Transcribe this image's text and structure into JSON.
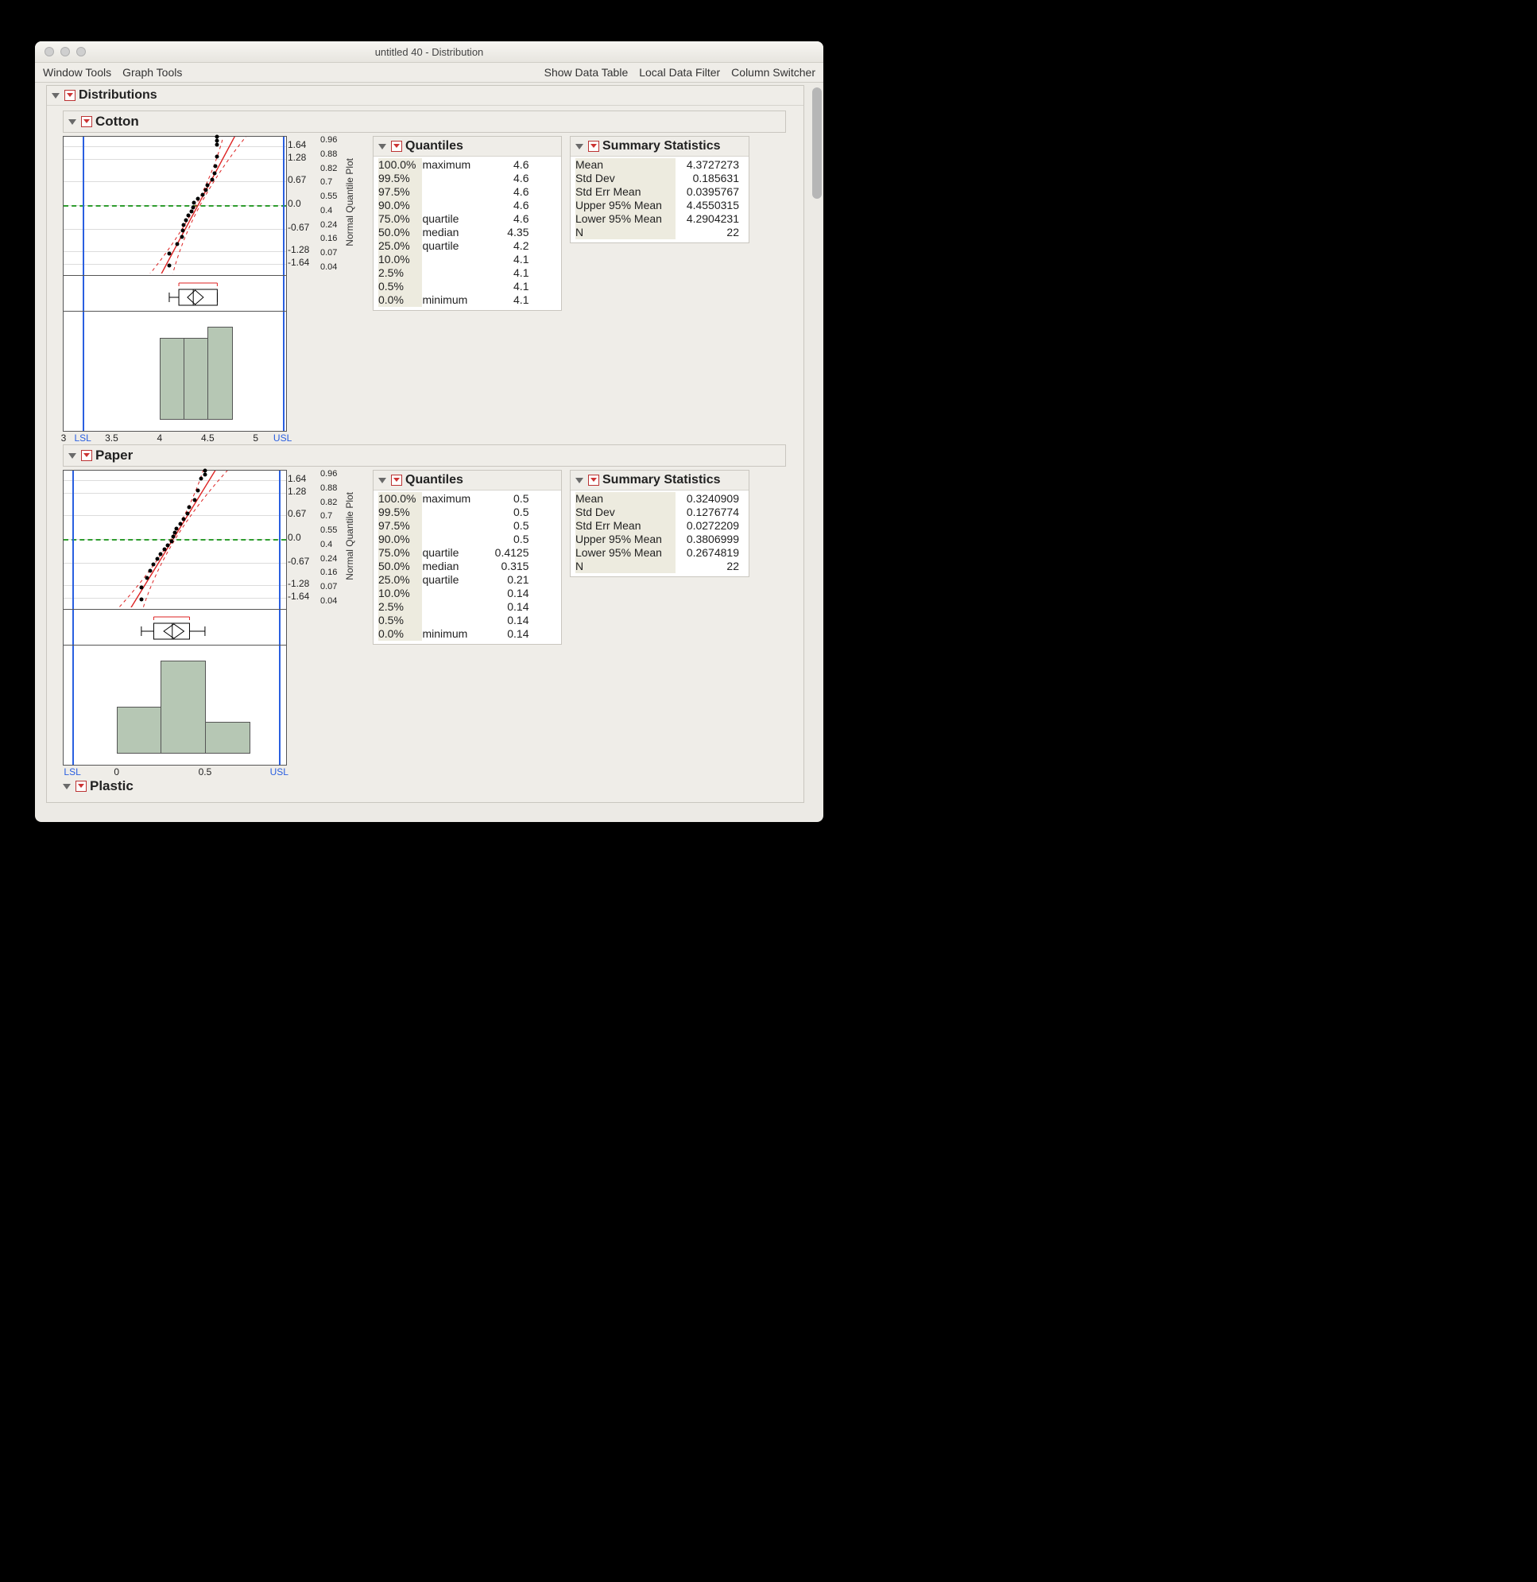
{
  "window": {
    "title": "untitled 40 - Distribution"
  },
  "menu": {
    "left": [
      "Window Tools",
      "Graph Tools"
    ],
    "right": [
      "Show Data Table",
      "Local Data Filter",
      "Column Switcher"
    ]
  },
  "root": {
    "title": "Distributions"
  },
  "sections": [
    {
      "name": "Cotton",
      "qplot": {
        "leftLabels": [
          "1.64",
          "1.28",
          "0.67",
          "0.0",
          "-0.67",
          "-1.28",
          "-1.64"
        ],
        "rightLabels": [
          "0.96",
          "0.88",
          "0.82",
          "0.7",
          "0.55",
          "0.4",
          "0.24",
          "0.16",
          "0.07",
          "0.04"
        ],
        "vtitle": "Normal Quantile Plot",
        "lsl": "LSL",
        "usl": "USL"
      },
      "histAxis": [
        "3",
        "3.5",
        "4",
        "4.5",
        "5"
      ],
      "quantiles": {
        "title": "Quantiles",
        "rows": [
          {
            "p": "100.0%",
            "t": "maximum",
            "v": "4.6"
          },
          {
            "p": "99.5%",
            "t": "",
            "v": "4.6"
          },
          {
            "p": "97.5%",
            "t": "",
            "v": "4.6"
          },
          {
            "p": "90.0%",
            "t": "",
            "v": "4.6"
          },
          {
            "p": "75.0%",
            "t": "quartile",
            "v": "4.6"
          },
          {
            "p": "50.0%",
            "t": "median",
            "v": "4.35"
          },
          {
            "p": "25.0%",
            "t": "quartile",
            "v": "4.2"
          },
          {
            "p": "10.0%",
            "t": "",
            "v": "4.1"
          },
          {
            "p": "2.5%",
            "t": "",
            "v": "4.1"
          },
          {
            "p": "0.5%",
            "t": "",
            "v": "4.1"
          },
          {
            "p": "0.0%",
            "t": "minimum",
            "v": "4.1"
          }
        ]
      },
      "summary": {
        "title": "Summary Statistics",
        "rows": [
          {
            "l": "Mean",
            "v": "4.3727273"
          },
          {
            "l": "Std Dev",
            "v": "0.185631"
          },
          {
            "l": "Std Err Mean",
            "v": "0.0395767"
          },
          {
            "l": "Upper 95% Mean",
            "v": "4.4550315"
          },
          {
            "l": "Lower 95% Mean",
            "v": "4.2904231"
          },
          {
            "l": "N",
            "v": "22"
          }
        ]
      }
    },
    {
      "name": "Paper",
      "qplot": {
        "leftLabels": [
          "1.64",
          "1.28",
          "0.67",
          "0.0",
          "-0.67",
          "-1.28",
          "-1.64"
        ],
        "rightLabels": [
          "0.96",
          "0.88",
          "0.82",
          "0.7",
          "0.55",
          "0.4",
          "0.24",
          "0.16",
          "0.07",
          "0.04"
        ],
        "vtitle": "Normal Quantile Plot",
        "lsl": "LSL",
        "usl": "USL"
      },
      "histAxis": [
        "0",
        "0.5"
      ],
      "quantiles": {
        "title": "Quantiles",
        "rows": [
          {
            "p": "100.0%",
            "t": "maximum",
            "v": "0.5"
          },
          {
            "p": "99.5%",
            "t": "",
            "v": "0.5"
          },
          {
            "p": "97.5%",
            "t": "",
            "v": "0.5"
          },
          {
            "p": "90.0%",
            "t": "",
            "v": "0.5"
          },
          {
            "p": "75.0%",
            "t": "quartile",
            "v": "0.4125"
          },
          {
            "p": "50.0%",
            "t": "median",
            "v": "0.315"
          },
          {
            "p": "25.0%",
            "t": "quartile",
            "v": "0.21"
          },
          {
            "p": "10.0%",
            "t": "",
            "v": "0.14"
          },
          {
            "p": "2.5%",
            "t": "",
            "v": "0.14"
          },
          {
            "p": "0.5%",
            "t": "",
            "v": "0.14"
          },
          {
            "p": "0.0%",
            "t": "minimum",
            "v": "0.14"
          }
        ]
      },
      "summary": {
        "title": "Summary Statistics",
        "rows": [
          {
            "l": "Mean",
            "v": "0.3240909"
          },
          {
            "l": "Std Dev",
            "v": "0.1276774"
          },
          {
            "l": "Std Err Mean",
            "v": "0.0272209"
          },
          {
            "l": "Upper 95% Mean",
            "v": "0.3806999"
          },
          {
            "l": "Lower 95% Mean",
            "v": "0.2674819"
          },
          {
            "l": "N",
            "v": "22"
          }
        ]
      }
    }
  ],
  "cutoff": {
    "name": "Plastic"
  },
  "chart_data": [
    {
      "variable": "Cotton",
      "normal_quantile_plot": {
        "type": "scatter",
        "title": "Normal Quantile Plot",
        "ylim": [
          -1.9,
          1.9
        ],
        "xlim": [
          3.0,
          5.3
        ],
        "x": [
          4.1,
          4.1,
          4.18,
          4.23,
          4.24,
          4.25,
          4.27,
          4.3,
          4.33,
          4.35,
          4.36,
          4.4,
          4.45,
          4.48,
          4.5,
          4.55,
          4.57,
          4.58,
          4.6,
          4.6,
          4.6,
          4.6
        ],
        "normal_quantile": [
          -1.69,
          -1.34,
          -1.08,
          -0.88,
          -0.71,
          -0.56,
          -0.42,
          -0.29,
          -0.17,
          -0.06,
          0.06,
          0.17,
          0.29,
          0.42,
          0.56,
          0.71,
          0.88,
          1.08,
          1.34,
          1.69,
          1.8,
          1.9
        ],
        "fit_line": {
          "xrange": [
            3.9,
            4.9
          ],
          "yrange": [
            -2.5,
            2.5
          ]
        },
        "spec_limits": {
          "LSL": 3.2,
          "USL": 5.28
        }
      },
      "box_plot": {
        "type": "boxplot",
        "min": 4.1,
        "q1": 4.2,
        "median": 4.35,
        "q3": 4.6,
        "max": 4.6,
        "mean": 4.37,
        "ci": [
          4.29,
          4.455
        ]
      },
      "histogram": {
        "type": "bar",
        "bin_edges": [
          4.0,
          4.25,
          4.5,
          4.75
        ],
        "counts": [
          7,
          7,
          8
        ],
        "xlim": [
          3.0,
          5.3
        ]
      }
    },
    {
      "variable": "Paper",
      "normal_quantile_plot": {
        "type": "scatter",
        "title": "Normal Quantile Plot",
        "ylim": [
          -1.9,
          1.9
        ],
        "xlim": [
          -0.3,
          0.95
        ],
        "x": [
          0.14,
          0.14,
          0.17,
          0.19,
          0.21,
          0.23,
          0.25,
          0.27,
          0.29,
          0.31,
          0.32,
          0.33,
          0.34,
          0.36,
          0.38,
          0.4,
          0.41,
          0.44,
          0.46,
          0.48,
          0.5,
          0.5
        ],
        "normal_quantile": [
          -1.69,
          -1.34,
          -1.08,
          -0.88,
          -0.71,
          -0.56,
          -0.42,
          -0.29,
          -0.17,
          -0.06,
          0.06,
          0.17,
          0.29,
          0.42,
          0.56,
          0.71,
          0.88,
          1.08,
          1.34,
          1.69,
          1.8,
          1.9
        ],
        "fit_line": {
          "xrange": [
            0.02,
            0.62
          ],
          "yrange": [
            -2.4,
            2.4
          ]
        },
        "spec_limits": {
          "LSL": -0.25,
          "USL": 0.92
        }
      },
      "box_plot": {
        "type": "boxplot",
        "min": 0.14,
        "q1": 0.21,
        "median": 0.315,
        "q3": 0.4125,
        "max": 0.5,
        "mean": 0.324,
        "ci": [
          0.267,
          0.381
        ]
      },
      "histogram": {
        "type": "bar",
        "bin_edges": [
          0.0,
          0.25,
          0.5,
          0.75
        ],
        "counts": [
          6,
          12,
          4
        ],
        "xlim": [
          -0.3,
          0.95
        ]
      }
    }
  ]
}
